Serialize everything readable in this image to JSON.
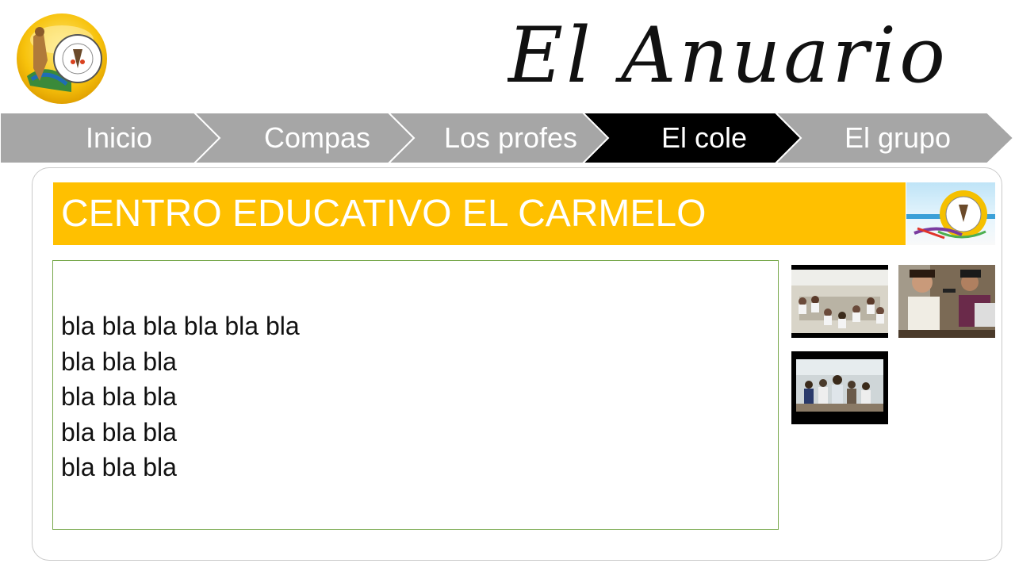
{
  "header": {
    "title": "El Anuario",
    "logo_icon": "school-crest-icon"
  },
  "nav": {
    "items": [
      {
        "label": "Inicio",
        "active": false
      },
      {
        "label": "Compas",
        "active": false
      },
      {
        "label": "Los profes",
        "active": false
      },
      {
        "label": "El cole",
        "active": true
      },
      {
        "label": "El grupo",
        "active": false
      }
    ],
    "inactive_color": "#a6a6a6",
    "active_color": "#000000"
  },
  "main": {
    "heading": "CENTRO EDUCATIVO EL CARMELO",
    "heading_color": "#ffc000",
    "text_lines": [
      "bla bla bla bla bla bla",
      "bla bla bla",
      "bla bla bla",
      "bla bla bla",
      "bla bla bla"
    ],
    "photos": [
      {
        "name": "classroom-photo"
      },
      {
        "name": "radio-microphone-photo"
      },
      {
        "name": "group-room-photo"
      }
    ]
  }
}
